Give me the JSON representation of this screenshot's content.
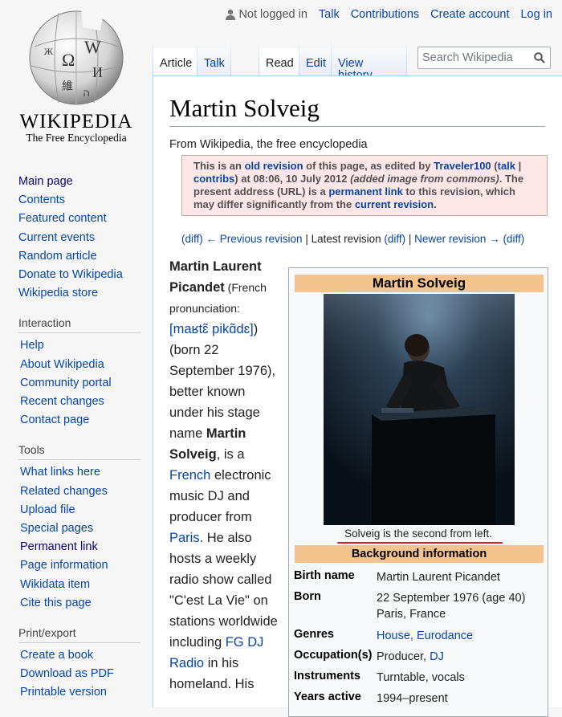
{
  "logo": {
    "wordmark": "WIKIPEDIA",
    "tagline": "The Free Encyclopedia",
    "icon": "wikipedia-globe-icon"
  },
  "personal": {
    "not_logged_in": "Not logged in",
    "talk": "Talk",
    "contributions": "Contributions",
    "create_account": "Create account",
    "log_in": "Log in"
  },
  "sidebar": {
    "navigation": [
      "Main page",
      "Contents",
      "Featured content",
      "Current events",
      "Random article",
      "Donate to Wikipedia",
      "Wikipedia store"
    ],
    "interaction": {
      "heading": "Interaction",
      "items": [
        "Help",
        "About Wikipedia",
        "Community portal",
        "Recent changes",
        "Contact page"
      ]
    },
    "tools": {
      "heading": "Tools",
      "items": [
        "What links here",
        "Related changes",
        "Upload file",
        "Special pages",
        "Permanent link",
        "Page information",
        "Wikidata item",
        "Cite this page"
      ]
    },
    "print": {
      "heading": "Print/export",
      "items": [
        "Create a book",
        "Download as PDF",
        "Printable version"
      ]
    }
  },
  "tabs": {
    "article": "Article",
    "talk": "Talk",
    "read": "Read",
    "edit": "Edit",
    "view_history": "View history"
  },
  "search": {
    "placeholder": "Search Wikipedia"
  },
  "page": {
    "title": "Martin Solveig",
    "site_sub": "From Wikipedia, the free encyclopedia"
  },
  "revision": {
    "t1": "This is an ",
    "old_revision": "old revision",
    "t2": " of this page, as edited by ",
    "editor": "Traveler100",
    "t3": " (",
    "talk": "talk",
    "sep": " | ",
    "contribs": "contribs",
    "t4": ") at 08:06, 10 July 2012 ",
    "summary": "(added image from commons)",
    "t5": ". The present address (URL) is a ",
    "permanent_link": "permanent link",
    "t6": " to this revision, which may differ significantly from the ",
    "current_revision": "current revision",
    "t7": "."
  },
  "revnav": {
    "diff1": "(diff)",
    "prev": " ← Previous revision",
    "bar1": " | ",
    "latest": "Latest revision",
    "diff2": " (diff)",
    "bar2": " | ",
    "newer": "Newer revision →",
    "diff3": " (diff)"
  },
  "lead": {
    "name": "Martin Laurent Picandet",
    "pron_open": " (French pronunciation:",
    "ipa": "[maʁtɛ̃ pikɑ̃dɛ]",
    "pron_close": ")",
    "born": " (born 22 September 1976), better known under his stage name ",
    "stage_name": "Martin Solveig",
    "is_a": ", is a ",
    "french": "French",
    "desc": " electronic music DJ and producer from ",
    "paris": "Paris",
    "also": ". He also hosts a weekly radio show called \"C'est La Vie\" on stations worldwide including ",
    "fg": "FG DJ Radio",
    "tail": " in his homeland. His"
  },
  "infobox": {
    "title": "Martin Solveig",
    "caption": "Solveig is the second from left.",
    "section": "Background information",
    "rows": [
      {
        "label": "Birth name",
        "value": "Martin Laurent Picandet"
      },
      {
        "label": "Born",
        "value": "22 September 1976 (age 40)",
        "value2": "Paris, France"
      },
      {
        "label": "Genres",
        "value": "House, Eurodance"
      },
      {
        "label": "Occupation(s)",
        "value": "Producer, ",
        "link": "DJ"
      },
      {
        "label": "Instruments",
        "value": "Turntable, vocals"
      },
      {
        "label": "Years active",
        "value": "1994–present"
      }
    ]
  },
  "colors": {
    "link": "#0645ad",
    "infobox_header": "#f4c38e",
    "revision_box": "#fee7e6",
    "annotation_underline": "#e21818"
  }
}
